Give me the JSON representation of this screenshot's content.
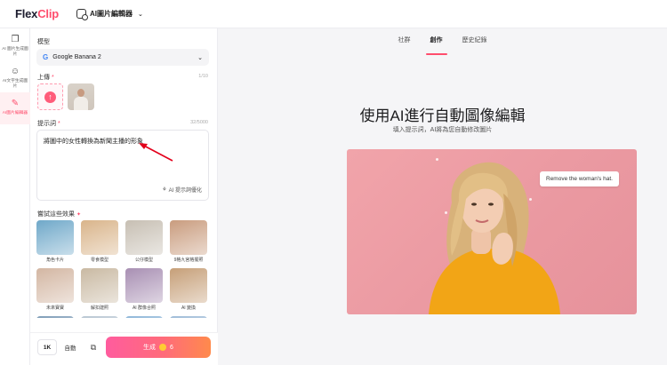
{
  "header": {
    "logo_prefix": "Flex",
    "logo_suffix": "Clip",
    "app_name": "AI圖片編輯器"
  },
  "rail": {
    "items": [
      {
        "label": "AI 圖片生成圖片",
        "icon": "images-icon"
      },
      {
        "label": "AI文字生成圖片",
        "icon": "text-image-icon"
      },
      {
        "label": "AI圖片編輯器",
        "icon": "edit-image-icon",
        "active": true
      }
    ]
  },
  "panel": {
    "model_label": "模型",
    "model_value": "Google Banana 2",
    "upload_label": "上傳",
    "upload_count": "1/10",
    "prompt_label": "提示詞",
    "prompt_count": "32/5000",
    "prompt_text": "將圖中的女性轉換為新聞主播的形象",
    "enhance_label": "AI 提示詞優化",
    "effects_title": "嘗試這些效果",
    "effects": [
      {
        "label": "角色卡片",
        "color": "#6fa8c9"
      },
      {
        "label": "零食模型",
        "color": "#d9b48a"
      },
      {
        "label": "公仔模型",
        "color": "#c7bfb3"
      },
      {
        "label": "9格九宮格擺照",
        "color": "#c99c7e"
      },
      {
        "label": "未來寶寶",
        "color": "#d3b6a2"
      },
      {
        "label": "解扣建照",
        "color": "#c9b9a2"
      },
      {
        "label": "AI 群像合照",
        "color": "#a88fb3"
      },
      {
        "label": "AI 變換",
        "color": "#c69f78"
      },
      {
        "label": "",
        "color": "#7f9db8"
      },
      {
        "label": "",
        "color": "#b9c7d3"
      },
      {
        "label": "",
        "color": "#8fb7d9"
      },
      {
        "label": "",
        "color": "#9fbcd8"
      }
    ]
  },
  "footer": {
    "resolution": "1K",
    "ratio": "自動",
    "generate_label": "生成",
    "generate_cost": "6"
  },
  "main": {
    "tabs": [
      {
        "label": "社群"
      },
      {
        "label": "創作",
        "active": true
      },
      {
        "label": "歷史紀錄"
      }
    ],
    "headline": "使用AI進行自動圖像編輯",
    "subline": "填入提示詞，AI將為您自動修改圖片",
    "tooltip": "Remove the woman's hat."
  },
  "colors": {
    "accent": "#ff4d6d",
    "hero_bg": "#eb9aa2",
    "shirt": "#f2a516"
  }
}
